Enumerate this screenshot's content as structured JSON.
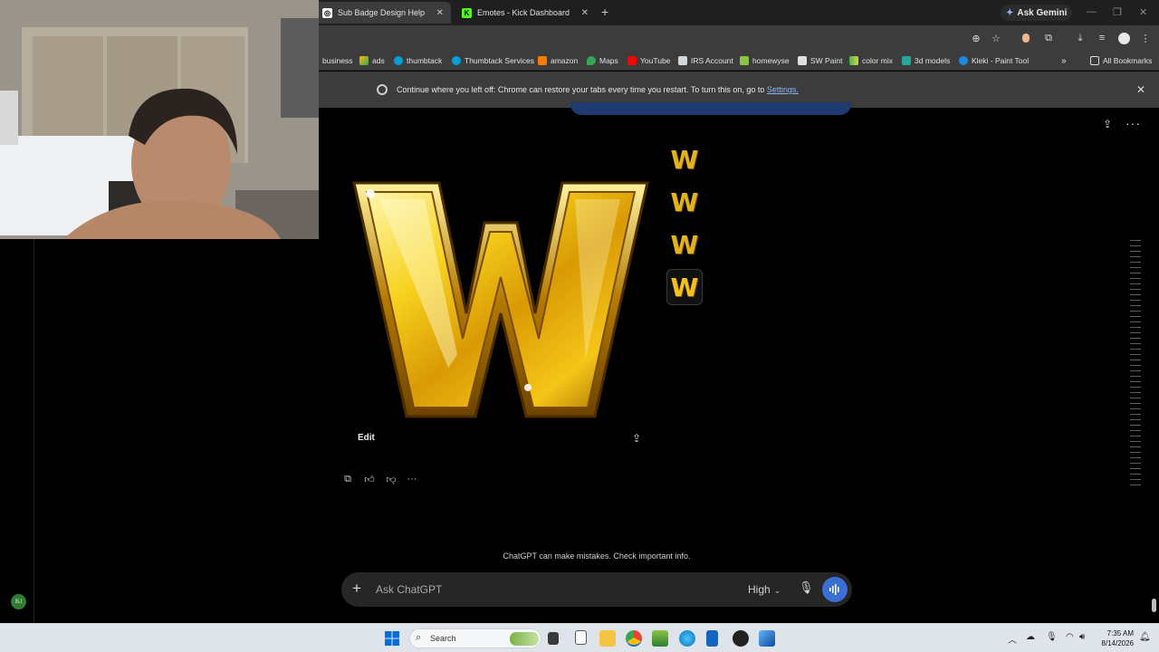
{
  "tabs": [
    {
      "title": "Sub Badge Design Help",
      "active": true
    },
    {
      "title": "Emotes - Kick Dashboard",
      "active": false
    }
  ],
  "gemini_label": "Ask Gemini",
  "bookmarks": [
    "business",
    "ads",
    "thumbtack",
    "Thumbtack Services",
    "amazon",
    "Maps",
    "YouTube",
    "IRS Account",
    "homewyse",
    "SW Paint",
    "color mix",
    "3d models",
    "Kleki - Paint Tool"
  ],
  "all_bookmarks": "All Bookmarks",
  "infobar": {
    "message": "Continue where you left off: Chrome can restore your tabs every time you restart. To turn this on, go to ",
    "link": "Settings."
  },
  "image_actions": {
    "edit": "Edit"
  },
  "disclaimer": "ChatGPT can make mistakes. Check important info.",
  "composer": {
    "placeholder": "Ask ChatGPT",
    "model": "High"
  },
  "avatar_initials": "BJ",
  "taskbar": {
    "search": "Search",
    "time": "7:35 AM",
    "date": "8/14/2026"
  },
  "colors": {
    "gold": "#f2c21a",
    "accent_blue": "#3b6fd3",
    "chrome_bg": "#3c3c3c"
  }
}
